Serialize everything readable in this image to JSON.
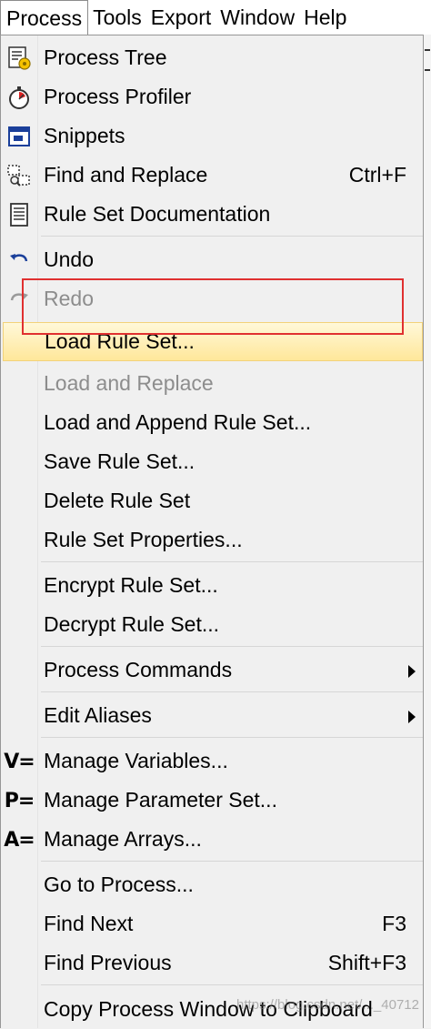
{
  "menubar": {
    "items": [
      {
        "label": "Process",
        "active": true
      },
      {
        "label": "Tools"
      },
      {
        "label": "Export"
      },
      {
        "label": "Window"
      },
      {
        "label": "Help"
      }
    ]
  },
  "menu": {
    "items": [
      {
        "label": "Process Tree",
        "icon": "process-tree-icon"
      },
      {
        "label": "Process Profiler",
        "icon": "stopwatch-icon"
      },
      {
        "label": "Snippets",
        "icon": "snippets-icon"
      },
      {
        "label": "Find and Replace",
        "icon": "find-replace-icon",
        "shortcut": "Ctrl+F"
      },
      {
        "label": "Rule Set Documentation",
        "icon": "document-icon"
      },
      {
        "label": "Undo",
        "icon": "undo-icon"
      },
      {
        "label": "Redo",
        "icon": "redo-icon",
        "disabled": true
      },
      {
        "label": "Load Rule Set...",
        "highlighted": true
      },
      {
        "label": "Load and Replace",
        "disabled": true
      },
      {
        "label": "Load and Append Rule Set..."
      },
      {
        "label": "Save Rule Set..."
      },
      {
        "label": "Delete Rule Set"
      },
      {
        "label": "Rule Set Properties..."
      },
      {
        "label": "Encrypt Rule Set..."
      },
      {
        "label": "Decrypt Rule Set..."
      },
      {
        "label": "Process Commands",
        "submenu": true
      },
      {
        "label": "Edit Aliases",
        "submenu": true
      },
      {
        "label": "Manage Variables...",
        "icon_text": "V="
      },
      {
        "label": "Manage Parameter Set...",
        "icon_text": "P="
      },
      {
        "label": "Manage Arrays...",
        "icon_text": "A="
      },
      {
        "label": "Go to Process..."
      },
      {
        "label": "Find Next",
        "shortcut": "F3"
      },
      {
        "label": "Find Previous",
        "shortcut": "Shift+F3"
      },
      {
        "label": "Copy Process Window to Clipboard"
      }
    ]
  },
  "watermark": "https://blog.csdn.net/..._40712",
  "colors": {
    "highlight_top": "#fff8d9",
    "highlight_bottom": "#ffe79a",
    "annotation_red": "#e03030",
    "disabled_text": "#8d8d8d"
  }
}
